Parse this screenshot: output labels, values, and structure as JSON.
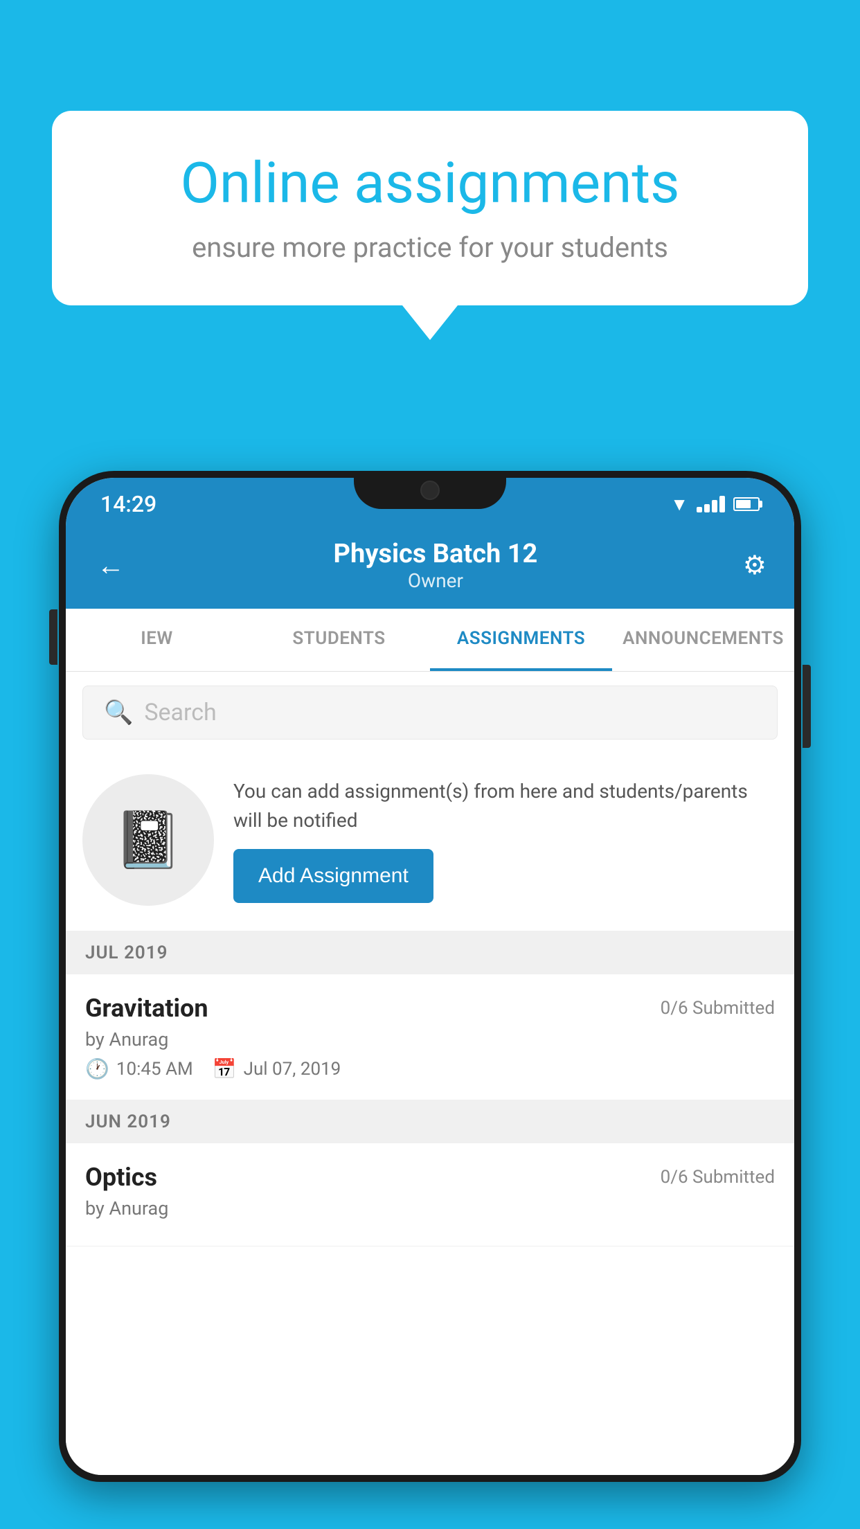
{
  "background_color": "#1BB8E8",
  "speech_bubble": {
    "title": "Online assignments",
    "subtitle": "ensure more practice for your students"
  },
  "phone": {
    "status_bar": {
      "time": "14:29"
    },
    "header": {
      "title": "Physics Batch 12",
      "subtitle": "Owner",
      "back_label": "←",
      "settings_label": "⚙"
    },
    "tabs": [
      {
        "label": "IEW",
        "active": false
      },
      {
        "label": "STUDENTS",
        "active": false
      },
      {
        "label": "ASSIGNMENTS",
        "active": true
      },
      {
        "label": "ANNOUNCEMENTS",
        "active": false
      }
    ],
    "search": {
      "placeholder": "Search"
    },
    "add_assignment_section": {
      "description": "You can add assignment(s) from here and students/parents will be notified",
      "button_label": "Add Assignment"
    },
    "assignments": [
      {
        "month_label": "JUL 2019",
        "items": [
          {
            "name": "Gravitation",
            "submitted": "0/6 Submitted",
            "author": "by Anurag",
            "time": "10:45 AM",
            "date": "Jul 07, 2019"
          }
        ]
      },
      {
        "month_label": "JUN 2019",
        "items": [
          {
            "name": "Optics",
            "submitted": "0/6 Submitted",
            "author": "by Anurag",
            "time": "",
            "date": ""
          }
        ]
      }
    ]
  }
}
